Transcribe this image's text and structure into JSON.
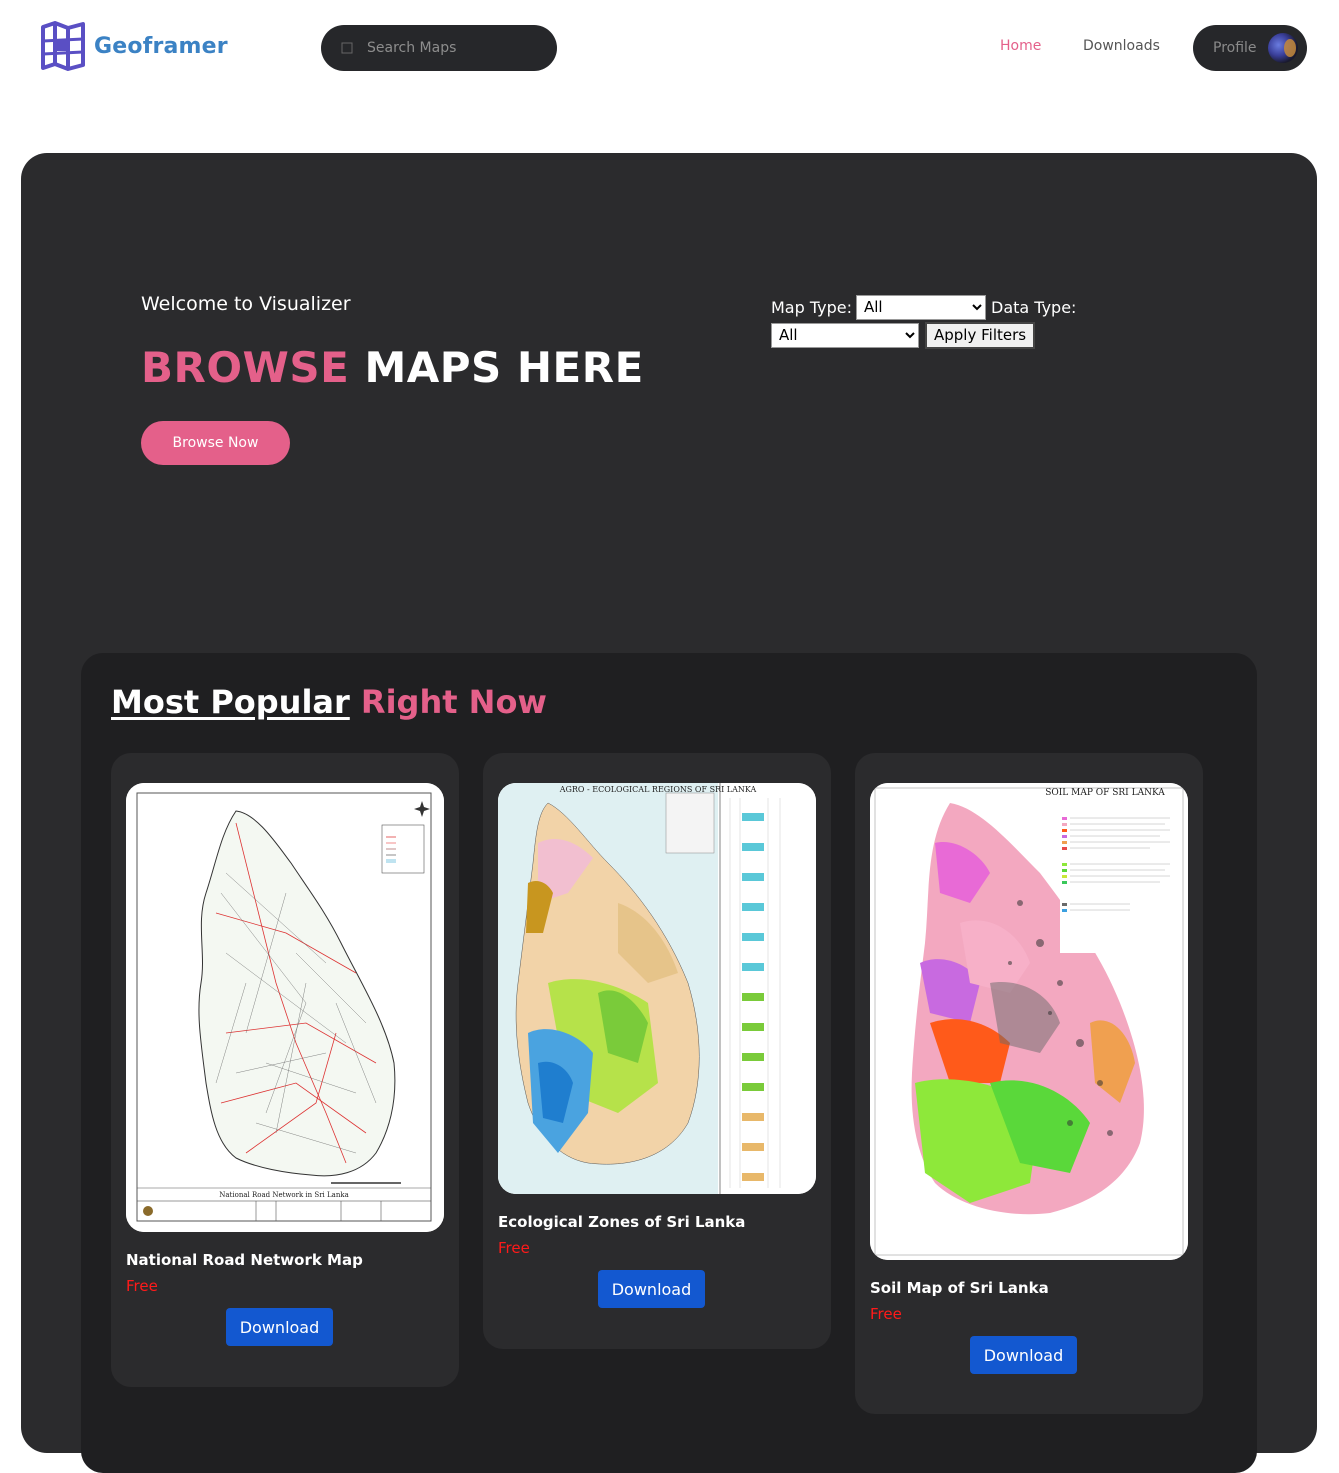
{
  "brand": {
    "name": "Geoframer",
    "logo_icon": "map-grid-icon",
    "logo_color": "#3b82c4"
  },
  "search": {
    "placeholder": "Search Maps",
    "icon": "search-icon"
  },
  "nav": {
    "home": "Home",
    "downloads": "Downloads",
    "profile": "Profile",
    "active_color": "#e4608a"
  },
  "hero": {
    "welcome": "Welcome to Visualizer",
    "headline_accent": "BROWSE",
    "headline_rest": "MAPS HERE",
    "cta": "Browse Now",
    "accent_color": "#e4608a"
  },
  "filters": {
    "map_type_label": "Map Type:",
    "map_type_value": "All",
    "data_type_label": "Data Type:",
    "data_type_value": "All",
    "apply": "Apply Filters"
  },
  "popular": {
    "title_main": "Most Popular",
    "title_accent": "Right Now",
    "cards": [
      {
        "name": "National Road Network Map",
        "price": "Free",
        "button": "Download",
        "thumb_title": "National Road Network in Sri Lanka"
      },
      {
        "name": "Ecological Zones of Sri Lanka",
        "price": "Free",
        "button": "Download",
        "thumb_title": "AGRO - ECOLOGICAL REGIONS OF SRI LANKA"
      },
      {
        "name": "Soil Map of Sri Lanka",
        "price": "Free",
        "button": "Download",
        "thumb_title": "SOIL MAP OF SRI LANKA"
      }
    ]
  },
  "colors": {
    "download_button": "#1358d0",
    "price": "#ff1a1a",
    "panel": "#2b2b2d",
    "section": "#1f1f21"
  }
}
